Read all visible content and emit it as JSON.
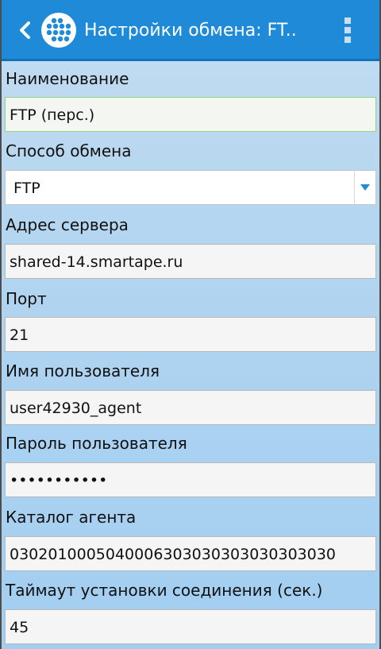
{
  "appbar": {
    "title": "Настройки обмена: FT..",
    "back_icon": "chevron-left-icon",
    "logo_icon": "app-logo-dots-icon",
    "menu_icon": "overflow-menu-icon"
  },
  "form": {
    "name_label": "Наименование",
    "name_value": "FTP (перс.)",
    "method_label": "Способ обмена",
    "method_value": "FTP",
    "server_label": "Адрес сервера",
    "server_value": "shared-14.smartape.ru",
    "port_label": "Порт",
    "port_value": "21",
    "user_label": "Имя пользователя",
    "user_value": "user42930_agent",
    "password_label": "Пароль пользователя",
    "password_value": "•••••••••••",
    "catalog_label": "Каталог агента",
    "catalog_value": "0302010005040006303030303030303030",
    "timeout_label": "Таймаут установки соединения (сек.)",
    "timeout_value": "45"
  },
  "colors": {
    "appbar": "#1e8ad8",
    "background": "#b4d6f0",
    "accent_arrow": "#1e8ad8",
    "active_border": "#9ad07f"
  }
}
